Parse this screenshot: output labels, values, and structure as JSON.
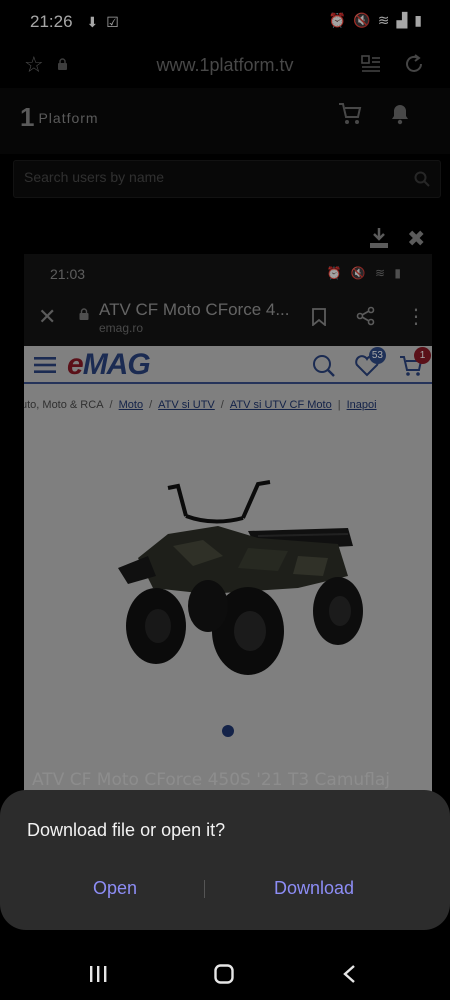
{
  "status_bar": {
    "time": "21:26",
    "icons": [
      "download-icon",
      "check-icon",
      "alarm-icon",
      "mute-icon",
      "wifi-icon",
      "signal-icon",
      "battery-icon"
    ]
  },
  "browser": {
    "url": "www.1platform.tv"
  },
  "site": {
    "logo_mark": "1",
    "logo_name": "Platform",
    "search_placeholder": "Search users by name"
  },
  "embedded": {
    "status_time": "21:03",
    "status_icons": "⏰ 🔇 ≋ ▮",
    "page_title": "ATV CF Moto CForce 4...",
    "domain": "emag.ro",
    "emag": {
      "logo_e": "e",
      "logo_rest": "MAG",
      "favorites_badge": "53",
      "cart_badge": "1",
      "breadcrumb_start": "uto, Moto & RCA",
      "breadcrumbs": [
        "Moto",
        "ATV si UTV",
        "ATV si UTV CF Moto",
        "Inapoi"
      ]
    }
  },
  "product_title": "ATV CF Moto CForce 450S '21 T3 Camuflaj",
  "dialog": {
    "message": "Download file or open it?",
    "open_label": "Open",
    "download_label": "Download"
  },
  "colors": {
    "accent": "#8d8df5",
    "emag_blue": "#1f3670",
    "emag_red": "#8a1a26"
  }
}
